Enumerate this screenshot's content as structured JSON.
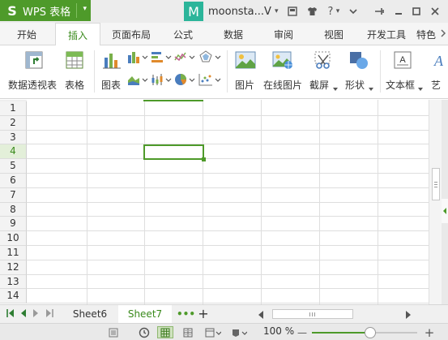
{
  "app": {
    "logo": "S",
    "name": "WPS 表格",
    "menu_caret": "▾"
  },
  "account": {
    "avatar_letter": "M",
    "username": "moonsta...V",
    "caret": "▾"
  },
  "titlebar_icons": {
    "skin": "▣",
    "shirt": "♟",
    "help": "?",
    "help_caret": "▾",
    "minimize_ribbon": "⌄",
    "pin": "⊣",
    "minimize": "—",
    "maximize": "□",
    "close": "✕"
  },
  "tabs": [
    "开始",
    "插入",
    "页面布局",
    "公式",
    "数据",
    "审阅",
    "视图",
    "开发工具",
    "特色"
  ],
  "active_tab": "插入",
  "ribbon": {
    "pivot_table": "数据透视表",
    "table": "表格",
    "chart": "图表",
    "picture": "图片",
    "online_picture": "在线图片",
    "screenshot": "截屏",
    "shapes": "形状",
    "textbox": "文本框",
    "more": "艺"
  },
  "rows": [
    "1",
    "2",
    "3",
    "4",
    "5",
    "6",
    "7",
    "8",
    "9",
    "10",
    "11",
    "12",
    "13",
    "14"
  ],
  "selected_row": "4",
  "sheets": [
    "Sheet6",
    "Sheet7"
  ],
  "active_sheet": "Sheet7",
  "sheet_more": "•••",
  "sheet_add": "+",
  "status": {
    "zoom": "100 %",
    "zoom_minus": "—",
    "zoom_plus": "+",
    "zoom_level": 0.55
  },
  "colors": {
    "accent": "#4e9a2a",
    "avatar": "#2bb59a"
  }
}
